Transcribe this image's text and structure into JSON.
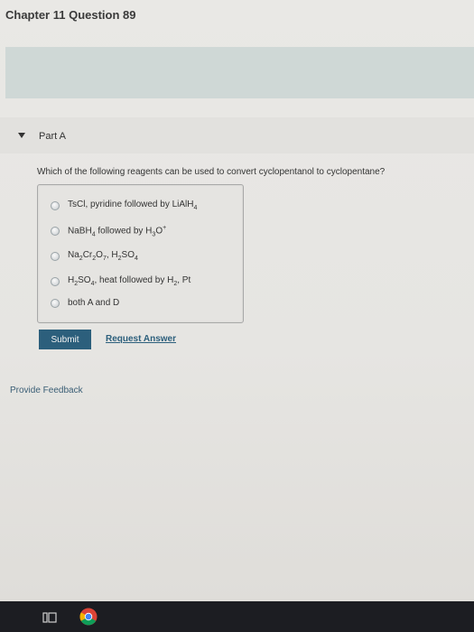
{
  "header": {
    "title": "Chapter 11 Question 89"
  },
  "part": {
    "label": "Part A"
  },
  "question": {
    "text": "Which of the following reagents can be used to convert cyclopentanol to cyclopentane?"
  },
  "options": [
    {
      "text": "TsCl, pyridine followed by LiAlH4"
    },
    {
      "text": "NaBH4 followed by H3O+"
    },
    {
      "text": "Na2Cr2O7, H2SO4"
    },
    {
      "text": "H2SO4, heat followed by H2, Pt"
    },
    {
      "text": "both A and D"
    }
  ],
  "actions": {
    "submit_label": "Submit",
    "request_answer_label": "Request Answer",
    "feedback_label": "Provide Feedback"
  },
  "taskbar": {
    "icons": [
      "task-view-icon",
      "chrome-icon"
    ]
  },
  "colors": {
    "accent": "#2c5f7c",
    "banner": "#cfd8d6",
    "background": "#e7e6e3",
    "taskbar": "#1c1d22"
  }
}
